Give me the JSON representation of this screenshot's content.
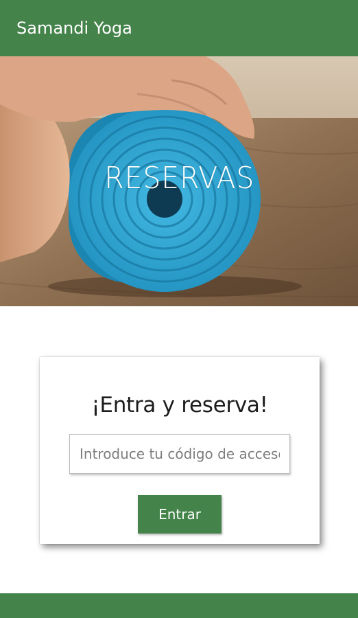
{
  "app_bar": {
    "title": "Samandi Yoga"
  },
  "hero": {
    "caption": "RESERVAS"
  },
  "login_card": {
    "heading": "¡Entra y reserva!",
    "access_code": {
      "value": "",
      "placeholder": "Introduce tu código de acceso"
    },
    "enter_label": "Entrar"
  },
  "colors": {
    "brand_green": "#44834a",
    "mat_blue": "#2fa4cf",
    "floor_wood": "#8a6c4e"
  },
  "icons": {
    "hero_image": "rolled-yoga-mat-photo"
  }
}
